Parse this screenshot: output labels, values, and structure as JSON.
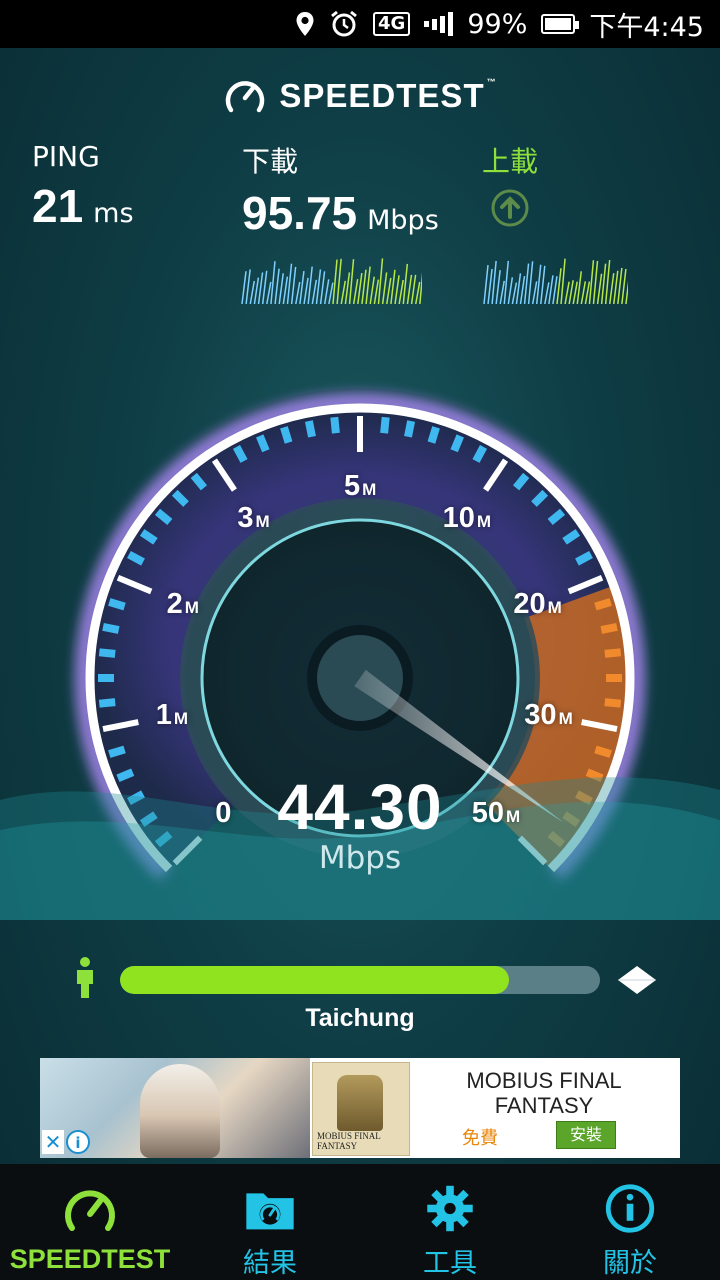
{
  "status_bar": {
    "battery": "99%",
    "battery_level": 0.99,
    "time": "下午4:45",
    "network": "4G",
    "icons": [
      "location-icon",
      "alarm-icon",
      "network-4g-icon",
      "signal-icon",
      "battery-icon"
    ]
  },
  "header": {
    "brand": "SPEEDTEST",
    "trademark": "™"
  },
  "ping": {
    "label": "PING",
    "value": "21",
    "unit": "ms"
  },
  "download": {
    "label": "下載",
    "value": "95.75",
    "unit": "Mbps"
  },
  "upload": {
    "label": "上載",
    "icon": "arrow-up-circle-icon"
  },
  "gauge": {
    "scale_labels": [
      {
        "num": "0",
        "unit": ""
      },
      {
        "num": "1",
        "unit": "M"
      },
      {
        "num": "2",
        "unit": "M"
      },
      {
        "num": "3",
        "unit": "M"
      },
      {
        "num": "5",
        "unit": "M"
      },
      {
        "num": "10",
        "unit": "M"
      },
      {
        "num": "20",
        "unit": "M"
      },
      {
        "num": "30",
        "unit": "M"
      },
      {
        "num": "50",
        "unit": "M"
      }
    ],
    "current_value": "44.30",
    "current_unit": "Mbps",
    "colors": {
      "low": "#3fb8ef",
      "high": "#f08a2c",
      "rim": "#ffffff",
      "glow": "#b58cff"
    }
  },
  "progress": {
    "fraction": 0.81,
    "server": "Taichung",
    "color": "#8fe41f"
  },
  "ad": {
    "title_line1": "MOBIUS FINAL",
    "title_line2": "FANTASY",
    "free": "免費",
    "install": "安裝",
    "logo_caption": "MOBIUS FINAL FANTASY",
    "close": "✕",
    "info": "i"
  },
  "nav": {
    "items": [
      {
        "label": "SPEEDTEST",
        "icon": "gauge-icon",
        "active": true
      },
      {
        "label": "結果",
        "icon": "results-folder-icon",
        "active": false
      },
      {
        "label": "工具",
        "icon": "gear-icon",
        "active": false
      },
      {
        "label": "關於",
        "icon": "info-icon",
        "active": false
      }
    ],
    "active_color": "#8ee03b",
    "color": "#23c3e6"
  }
}
